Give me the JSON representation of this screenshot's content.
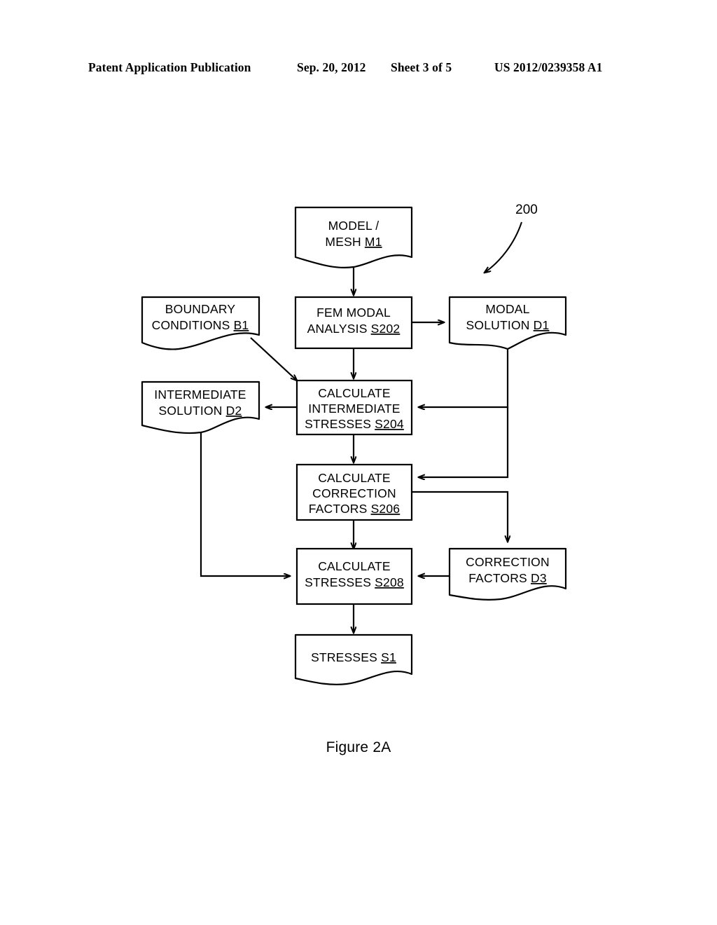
{
  "header": {
    "publication": "Patent Application Publication",
    "date": "Sep. 20, 2012",
    "sheet": "Sheet 3 of 5",
    "patent_number": "US 2012/0239358 A1"
  },
  "figure": {
    "caption": "Figure 2A",
    "reference_numeral": "200"
  },
  "nodes": {
    "model_mesh": {
      "line1": "MODEL /",
      "line2": "MESH ",
      "ref": "M1",
      "shape": "document"
    },
    "boundary_conditions": {
      "line1": "BOUNDARY",
      "line2": "CONDITIONS ",
      "ref": "B1",
      "shape": "document"
    },
    "fem_modal_analysis": {
      "line1": "FEM MODAL",
      "line2": "ANALYSIS ",
      "ref": "S202",
      "shape": "process"
    },
    "modal_solution": {
      "line1": "MODAL",
      "line2": "SOLUTION ",
      "ref": "D1",
      "shape": "document"
    },
    "intermediate_solution": {
      "line1": "INTERMEDIATE",
      "line2": "SOLUTION ",
      "ref": "D2",
      "shape": "document"
    },
    "calculate_intermediate_stresses": {
      "line1": "CALCULATE",
      "line2": "INTERMEDIATE",
      "line3": "STRESSES ",
      "ref": "S204",
      "shape": "process"
    },
    "calculate_correction_factors": {
      "line1": "CALCULATE",
      "line2": "CORRECTION",
      "line3": "FACTORS ",
      "ref": "S206",
      "shape": "process"
    },
    "correction_factors": {
      "line1": "CORRECTION",
      "line2": "FACTORS ",
      "ref": "D3",
      "shape": "document"
    },
    "calculate_stresses": {
      "line1": "CALCULATE",
      "line2": "STRESSES ",
      "ref": "S208",
      "shape": "process"
    },
    "stresses": {
      "line1": "STRESSES  ",
      "ref": "S1",
      "shape": "document"
    }
  },
  "colors": {
    "stroke": "#000000",
    "fill": "#ffffff",
    "text": "#000000"
  }
}
